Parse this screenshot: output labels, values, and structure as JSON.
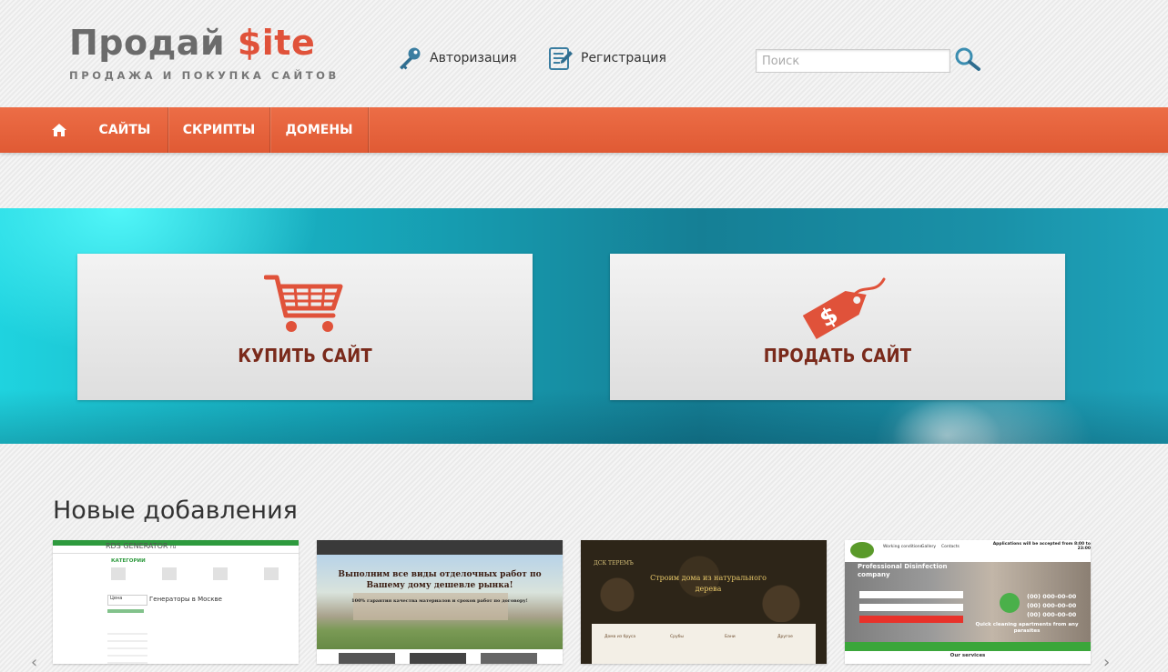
{
  "header": {
    "logo_main": "Продай ",
    "logo_accent": "$ite",
    "logo_sub": "ПРОДАЖА И ПОКУПКА САЙТОВ",
    "login_label": "Авторизация",
    "register_label": "Регистрация",
    "search_placeholder": "Поиск",
    "search_value": ""
  },
  "nav": {
    "home_icon": "home-icon",
    "items": [
      {
        "label": "САЙТЫ"
      },
      {
        "label": "СКРИПТЫ"
      },
      {
        "label": "ДОМЕНЫ"
      }
    ]
  },
  "banner": {
    "buy_label": "КУПИТЬ САЙТ",
    "buy_icon": "shopping-cart-icon",
    "sell_label": "ПРОДАТЬ САЙТ",
    "sell_icon": "price-tag-icon"
  },
  "section": {
    "title": "Новые добавления"
  },
  "colors": {
    "accent": "#e0523a",
    "nav_bg": "#e8633d",
    "banner_teal": "#17a8bb",
    "cta_text": "#7a2a1b"
  },
  "thumbnails": [
    {
      "brand": "RDS GENERATOR",
      "brand_suffix": "ru",
      "categories_label": "КАТЕГОРИИ",
      "headline": "Генераторы в Москве",
      "price_label": "Цена"
    },
    {
      "headline": "Выполним все виды отделочных работ по Вашему дому дешевле рынка!",
      "subline": "100% гарантия качества материалов и сроков работ по договору!"
    },
    {
      "brand": "ДСК ТЕРЕМЪ",
      "headline": "Строим дома из натурального дерева",
      "icons": [
        "Дома из бруса",
        "Срубы",
        "Бани",
        "Другое"
      ]
    },
    {
      "nav": [
        "Working conditions",
        "Gallery",
        "Contacts"
      ],
      "notice": "Applications will be accepted from 8:00 to 23:00",
      "headline": "Professional Disinfection company",
      "phone": "(00) 000-00-00",
      "tagline": "Quick cleaning apartments from any parasites",
      "services": "Our services"
    }
  ]
}
